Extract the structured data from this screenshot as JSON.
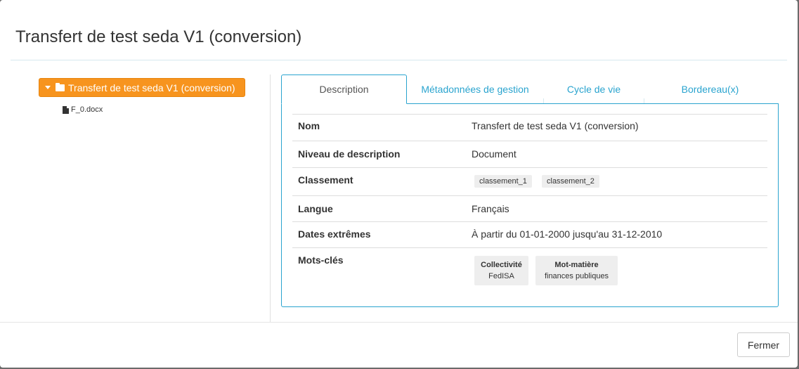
{
  "modal": {
    "title": "Transfert de test seda V1 (conversion)"
  },
  "tree": {
    "root_label": "Transfert de test seda V1 (conversion)",
    "children": [
      {
        "label": "F_0.docx",
        "icon": "file-icon"
      }
    ]
  },
  "tabs": [
    {
      "label": "Description",
      "active": true
    },
    {
      "label": "Métadonnées de gestion",
      "active": false
    },
    {
      "label": "Cycle de vie",
      "active": false
    },
    {
      "label": "Bordereau(x)",
      "active": false
    }
  ],
  "description": {
    "nom": {
      "label": "Nom",
      "value": "Transfert de test seda V1 (conversion)"
    },
    "niveau": {
      "label": "Niveau de description",
      "value": "Document"
    },
    "classement": {
      "label": "Classement",
      "tags": [
        "classement_1",
        "classement_2"
      ]
    },
    "langue": {
      "label": "Langue",
      "value": "Français"
    },
    "dates": {
      "label": "Dates extrêmes",
      "value": "À partir du 01-01-2000 jusqu'au 31-12-2010"
    },
    "mots_cles": {
      "label": "Mots-clés",
      "keywords": [
        {
          "type": "Collectivité",
          "value": "FedISA"
        },
        {
          "type": "Mot-matière",
          "value": "finances publiques"
        }
      ]
    }
  },
  "footer": {
    "close_label": "Fermer"
  },
  "colors": {
    "accent": "#2aa4cf",
    "tree_selected": "#f7941e"
  }
}
